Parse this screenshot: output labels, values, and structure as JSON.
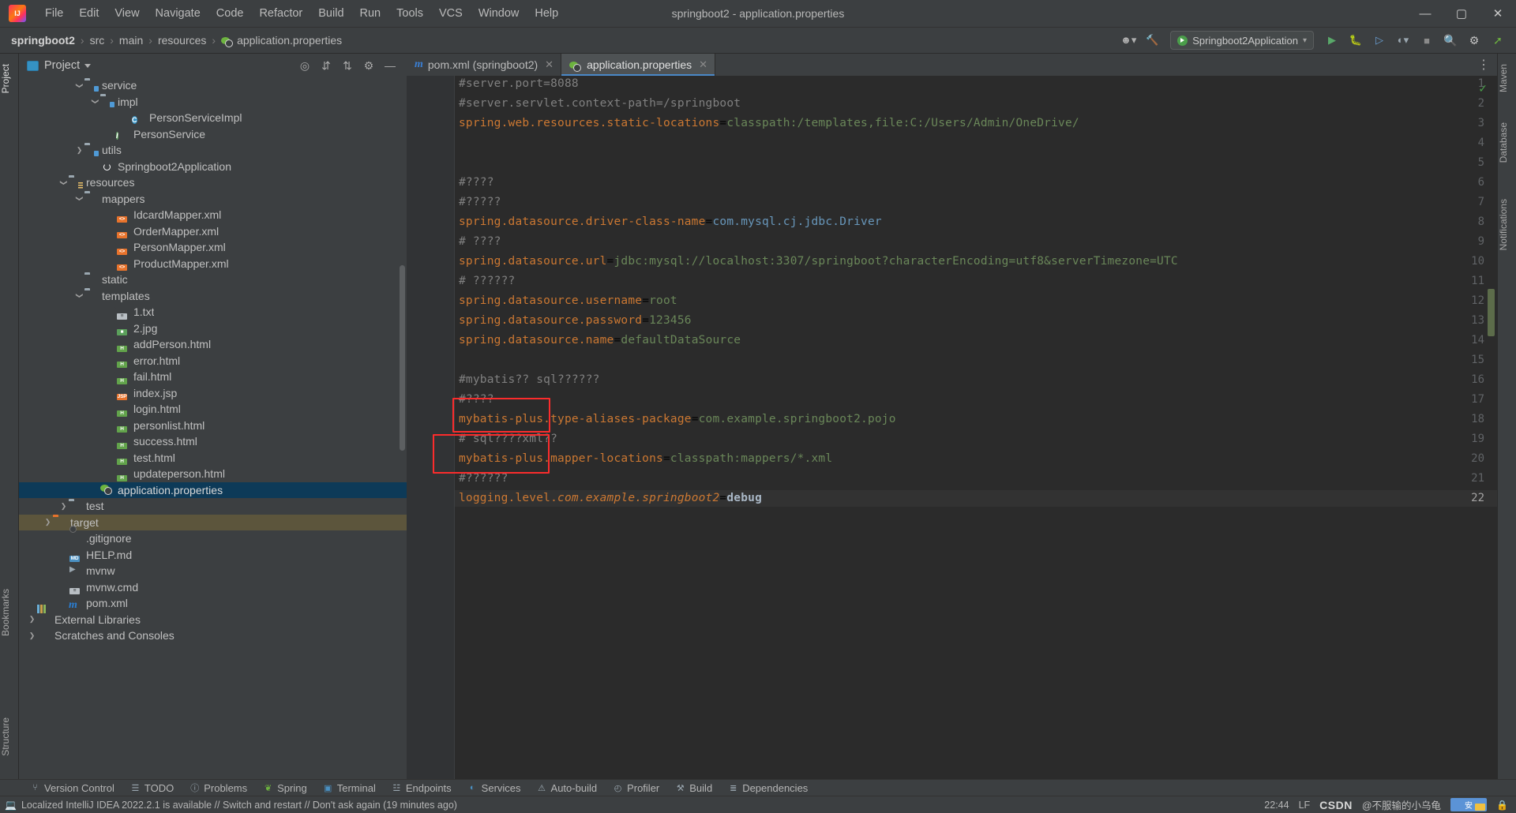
{
  "window": {
    "title": "springboot2 - application.properties",
    "logo_icon": "intellij-idea-logo",
    "minimize_icon": "—",
    "maximize_icon": "▢",
    "close_icon": "✕"
  },
  "menubar": {
    "items": [
      {
        "label": "File"
      },
      {
        "label": "Edit"
      },
      {
        "label": "View"
      },
      {
        "label": "Navigate"
      },
      {
        "label": "Code"
      },
      {
        "label": "Refactor"
      },
      {
        "label": "Build"
      },
      {
        "label": "Run"
      },
      {
        "label": "Tools"
      },
      {
        "label": "VCS"
      },
      {
        "label": "Window"
      },
      {
        "label": "Help"
      }
    ]
  },
  "navbar": {
    "breadcrumb": [
      {
        "label": "springboot2",
        "bold": true
      },
      {
        "label": "src",
        "bold": false
      },
      {
        "label": "main",
        "bold": false
      },
      {
        "label": "resources",
        "bold": false
      },
      {
        "label": "application.properties",
        "bold": false,
        "icon": "spring-properties-icon"
      }
    ],
    "separator": "›",
    "run_configuration": "Springboot2Application",
    "icons": {
      "user_icon": "user-account-icon",
      "hammer_icon": "build-hammer-icon",
      "run_icon": "run-icon",
      "debug_icon": "debug-icon",
      "run_coverage_icon": "run-with-coverage-icon",
      "profiler_icon": "profiler-icon",
      "stop_icon": "stop-icon",
      "search_icon": "search-everywhere-icon",
      "settings_icon": "settings-gear-icon",
      "updates_icon": "updates-icon",
      "chevron_icon": "chevron-down-icon"
    }
  },
  "left_strip": {
    "tabs": [
      {
        "label": "Project",
        "active": true
      },
      {
        "label": "Bookmarks",
        "active": false
      },
      {
        "label": "Structure",
        "active": false
      }
    ]
  },
  "right_strip": {
    "tabs": [
      {
        "label": "Maven",
        "active": false
      },
      {
        "label": "Database",
        "active": false
      },
      {
        "label": "Notifications",
        "active": false
      }
    ]
  },
  "project_panel": {
    "title": "Project",
    "icons": {
      "panel_icon": "project-view-icon",
      "dropdown_icon": "chevron-down-icon",
      "locate_icon": "select-opened-file-icon",
      "expand_icon": "expand-all-icon",
      "collapse_icon": "collapse-all-icon",
      "settings_icon": "gear-icon",
      "hide_icon": "hide-panel-icon"
    },
    "tree": [
      {
        "label": "service",
        "indent": 4,
        "arrow": "down",
        "icon": "folder-src",
        "state": "normal"
      },
      {
        "label": "impl",
        "indent": 5,
        "arrow": "down",
        "icon": "folder-src",
        "state": "normal"
      },
      {
        "label": "PersonServiceImpl",
        "indent": 7,
        "arrow": "none",
        "icon": "class",
        "state": "normal"
      },
      {
        "label": "PersonService",
        "indent": 6,
        "arrow": "none",
        "icon": "interface",
        "state": "normal"
      },
      {
        "label": "utils",
        "indent": 4,
        "arrow": "right",
        "icon": "folder-src",
        "state": "normal"
      },
      {
        "label": "Springboot2Application",
        "indent": 5,
        "arrow": "none",
        "icon": "spring-boot",
        "state": "normal"
      },
      {
        "label": "resources",
        "indent": 3,
        "arrow": "down",
        "icon": "folder-res",
        "state": "normal"
      },
      {
        "label": "mappers",
        "indent": 4,
        "arrow": "down",
        "icon": "folder",
        "state": "normal"
      },
      {
        "label": "IdcardMapper.xml",
        "indent": 6,
        "arrow": "none",
        "icon": "file-xml",
        "state": "normal"
      },
      {
        "label": "OrderMapper.xml",
        "indent": 6,
        "arrow": "none",
        "icon": "file-xml",
        "state": "normal"
      },
      {
        "label": "PersonMapper.xml",
        "indent": 6,
        "arrow": "none",
        "icon": "file-xml",
        "state": "normal"
      },
      {
        "label": "ProductMapper.xml",
        "indent": 6,
        "arrow": "none",
        "icon": "file-xml",
        "state": "normal"
      },
      {
        "label": "static",
        "indent": 4,
        "arrow": "none",
        "icon": "folder",
        "state": "normal"
      },
      {
        "label": "templates",
        "indent": 4,
        "arrow": "down",
        "icon": "folder",
        "state": "normal"
      },
      {
        "label": "1.txt",
        "indent": 6,
        "arrow": "none",
        "icon": "file-txt",
        "state": "normal"
      },
      {
        "label": "2.jpg",
        "indent": 6,
        "arrow": "none",
        "icon": "file-img",
        "state": "normal"
      },
      {
        "label": "addPerson.html",
        "indent": 6,
        "arrow": "none",
        "icon": "file-html",
        "state": "normal"
      },
      {
        "label": "error.html",
        "indent": 6,
        "arrow": "none",
        "icon": "file-html",
        "state": "normal"
      },
      {
        "label": "fail.html",
        "indent": 6,
        "arrow": "none",
        "icon": "file-html",
        "state": "normal"
      },
      {
        "label": "index.jsp",
        "indent": 6,
        "arrow": "none",
        "icon": "file-jsp",
        "state": "normal"
      },
      {
        "label": "login.html",
        "indent": 6,
        "arrow": "none",
        "icon": "file-html",
        "state": "normal"
      },
      {
        "label": "personlist.html",
        "indent": 6,
        "arrow": "none",
        "icon": "file-html",
        "state": "normal"
      },
      {
        "label": "success.html",
        "indent": 6,
        "arrow": "none",
        "icon": "file-html",
        "state": "normal"
      },
      {
        "label": "test.html",
        "indent": 6,
        "arrow": "none",
        "icon": "file-html",
        "state": "normal"
      },
      {
        "label": "updateperson.html",
        "indent": 6,
        "arrow": "none",
        "icon": "file-html",
        "state": "normal"
      },
      {
        "label": "application.properties",
        "indent": 5,
        "arrow": "none",
        "icon": "spring-properties",
        "state": "selected"
      },
      {
        "label": "test",
        "indent": 3,
        "arrow": "right",
        "icon": "folder",
        "state": "normal"
      },
      {
        "label": "target",
        "indent": 2,
        "arrow": "right",
        "icon": "folder-orange",
        "state": "excluded"
      },
      {
        "label": ".gitignore",
        "indent": 3,
        "arrow": "none",
        "icon": "file-git",
        "state": "normal"
      },
      {
        "label": "HELP.md",
        "indent": 3,
        "arrow": "none",
        "icon": "file-md",
        "state": "normal"
      },
      {
        "label": "mvnw",
        "indent": 3,
        "arrow": "none",
        "icon": "file-exec",
        "state": "normal"
      },
      {
        "label": "mvnw.cmd",
        "indent": 3,
        "arrow": "none",
        "icon": "file-txt-plain",
        "state": "normal"
      },
      {
        "label": "pom.xml",
        "indent": 3,
        "arrow": "none",
        "icon": "maven-pom",
        "state": "normal"
      },
      {
        "label": "External Libraries",
        "indent": 1,
        "arrow": "right",
        "icon": "libraries",
        "state": "normal"
      },
      {
        "label": "Scratches and Consoles",
        "indent": 1,
        "arrow": "right",
        "icon": "scratches",
        "state": "normal"
      }
    ]
  },
  "editor": {
    "tabs": [
      {
        "label": "pom.xml (springboot2)",
        "icon": "maven-icon",
        "active": false,
        "close": "✕"
      },
      {
        "label": "application.properties",
        "icon": "spring-properties-icon",
        "active": true,
        "close": "✕"
      }
    ],
    "inspection_status_icon": "no-problems-checkmark",
    "more_icon": "more-options-icon",
    "lines": [
      {
        "n": 1,
        "tokens": [
          {
            "t": "#server.port=8088",
            "c": "cmt"
          }
        ]
      },
      {
        "n": 2,
        "tokens": [
          {
            "t": "#server.servlet.context-path=/springboot",
            "c": "cmt"
          }
        ]
      },
      {
        "n": 3,
        "tokens": [
          {
            "t": "spring.web.resources.static-locations",
            "c": "key"
          },
          {
            "t": "=",
            "c": "plain"
          },
          {
            "t": "classpath:/templates,file:C:/Users/Admin/OneDrive/",
            "c": "val"
          }
        ]
      },
      {
        "n": 4,
        "tokens": []
      },
      {
        "n": 5,
        "tokens": []
      },
      {
        "n": 6,
        "tokens": [
          {
            "t": "#????",
            "c": "cmt"
          }
        ]
      },
      {
        "n": 7,
        "tokens": [
          {
            "t": "#?????",
            "c": "cmt"
          }
        ]
      },
      {
        "n": 8,
        "tokens": [
          {
            "t": "spring.datasource.driver-class-name",
            "c": "key"
          },
          {
            "t": "=",
            "c": "plain"
          },
          {
            "t": "com.mysql.cj.jdbc.Driver",
            "c": "num"
          }
        ]
      },
      {
        "n": 9,
        "tokens": [
          {
            "t": "# ????",
            "c": "cmt"
          }
        ]
      },
      {
        "n": 10,
        "tokens": [
          {
            "t": "spring.datasource.url",
            "c": "key"
          },
          {
            "t": "=",
            "c": "plain"
          },
          {
            "t": "jdbc:mysql://localhost:3307/springboot?characterEncoding=utf8&serverTimezone=UTC",
            "c": "val"
          }
        ]
      },
      {
        "n": 11,
        "tokens": [
          {
            "t": "# ??????",
            "c": "cmt"
          }
        ]
      },
      {
        "n": 12,
        "tokens": [
          {
            "t": "spring.datasource.username",
            "c": "key"
          },
          {
            "t": "=",
            "c": "plain"
          },
          {
            "t": "root",
            "c": "val"
          }
        ]
      },
      {
        "n": 13,
        "tokens": [
          {
            "t": "spring.datasource.password",
            "c": "key"
          },
          {
            "t": "=",
            "c": "plain"
          },
          {
            "t": "123456",
            "c": "val"
          }
        ]
      },
      {
        "n": 14,
        "tokens": [
          {
            "t": "spring.datasource.name",
            "c": "key"
          },
          {
            "t": "=",
            "c": "plain"
          },
          {
            "t": "defaultDataSource",
            "c": "val"
          }
        ]
      },
      {
        "n": 15,
        "tokens": []
      },
      {
        "n": 16,
        "tokens": [
          {
            "t": "#mybatis?? sql??????",
            "c": "cmt"
          }
        ]
      },
      {
        "n": 17,
        "tokens": [
          {
            "t": "#????",
            "c": "cmt"
          }
        ]
      },
      {
        "n": 18,
        "tokens": [
          {
            "t": "mybatis-plus.type-aliases-package",
            "c": "key"
          },
          {
            "t": "=",
            "c": "plain"
          },
          {
            "t": "com.example.springboot2.pojo",
            "c": "val"
          }
        ]
      },
      {
        "n": 19,
        "tokens": [
          {
            "t": "# sql????xml??",
            "c": "cmt"
          }
        ]
      },
      {
        "n": 20,
        "tokens": [
          {
            "t": "mybatis-plus.mapper-locations",
            "c": "key"
          },
          {
            "t": "=",
            "c": "plain"
          },
          {
            "t": "classpath:mappers/*.xml",
            "c": "val"
          }
        ]
      },
      {
        "n": 21,
        "tokens": [
          {
            "t": "#??????",
            "c": "cmt"
          }
        ]
      },
      {
        "n": 22,
        "tokens": [
          {
            "t": "logging.level.",
            "c": "key"
          },
          {
            "t": "com.example.springboot2",
            "c": "key ital"
          },
          {
            "t": "=",
            "c": "plain"
          },
          {
            "t": "debug",
            "c": "dbg"
          }
        ]
      }
    ],
    "current_line": 22,
    "annotations": [
      {
        "name": "highlight-box-line-18",
        "line": 18,
        "color": "#fb2c2c"
      },
      {
        "name": "highlight-box-line-20",
        "line": 20,
        "color": "#fb2c2c"
      }
    ]
  },
  "tool_window_bar": {
    "items": [
      {
        "label": "Version Control",
        "icon": "branch-icon"
      },
      {
        "label": "TODO",
        "icon": "list-icon"
      },
      {
        "label": "Problems",
        "icon": "problems-icon"
      },
      {
        "label": "Spring",
        "icon": "spring-leaf-icon"
      },
      {
        "label": "Terminal",
        "icon": "terminal-icon"
      },
      {
        "label": "Endpoints",
        "icon": "endpoints-icon"
      },
      {
        "label": "Services",
        "icon": "services-icon"
      },
      {
        "label": "Auto-build",
        "icon": "auto-build-icon"
      },
      {
        "label": "Profiler",
        "icon": "profiler-icon"
      },
      {
        "label": "Build",
        "icon": "build-hammer-icon"
      },
      {
        "label": "Dependencies",
        "icon": "dependencies-icon"
      }
    ]
  },
  "statusbar": {
    "message": "Localized IntelliJ IDEA 2022.2.1 is available // Switch and restart // Don't ask again (19 minutes ago)",
    "message_icon": "ide-update-icon",
    "time": "22:44",
    "line_separator": "LF",
    "watermark_brand": "CSDN",
    "watermark_author": "@不服输的小乌龟",
    "watermark_badge": "安",
    "encoding_icon": "encoding-indicator",
    "lock_icon": "read-only-lock-icon"
  },
  "colors": {
    "accent": "#4a88c7",
    "editor_bg": "#2b2b2b",
    "panel_bg": "#3c3f41",
    "selection": "#0d3a58",
    "annotation_red": "#fb2c2c",
    "keyword_orange": "#cc7832",
    "string_green": "#6a8759",
    "comment_gray": "#808080",
    "number_blue": "#6897bb"
  }
}
